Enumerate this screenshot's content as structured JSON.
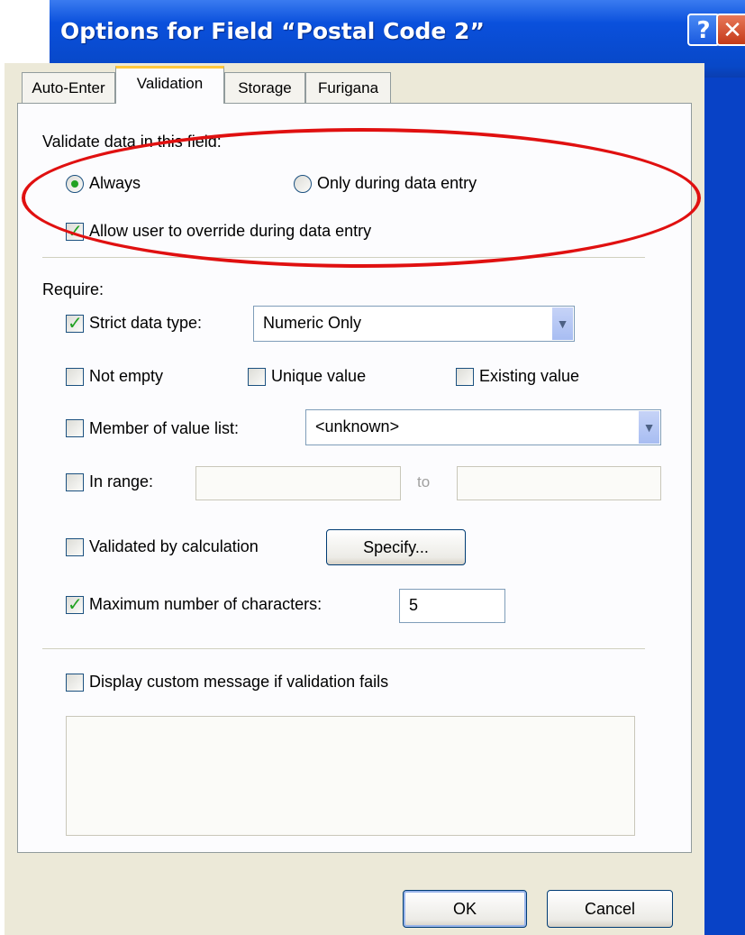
{
  "dialog": {
    "title": "Options for Field “Postal Code 2”",
    "help_icon_glyph": "?",
    "close_icon_glyph": "✕"
  },
  "tabs": [
    {
      "label": "Auto-Enter",
      "active": false
    },
    {
      "label": "Validation",
      "active": true
    },
    {
      "label": "Storage",
      "active": false
    },
    {
      "label": "Furigana",
      "active": false
    }
  ],
  "validate": {
    "heading": "Validate data in this field:",
    "always_label": "Always",
    "always_selected": true,
    "only_entry_label": "Only during data entry",
    "only_entry_selected": false,
    "override_label": "Allow user to override during data entry",
    "override_checked": true
  },
  "require": {
    "heading": "Require:",
    "strict_label": "Strict data type:",
    "strict_checked": true,
    "strict_value": "Numeric Only",
    "not_empty_label": "Not empty",
    "unique_label": "Unique value",
    "existing_label": "Existing value",
    "member_label": "Member of value list:",
    "member_value": "<unknown>",
    "range_label": "In range:",
    "range_to_label": "to",
    "calc_label": "Validated by calculation",
    "specify_label": "Specify...",
    "maxchars_label": "Maximum number of characters:",
    "maxchars_checked": true,
    "maxchars_value": "5"
  },
  "message": {
    "label": "Display custom message if validation fails",
    "checked": false,
    "text": ""
  },
  "footer": {
    "ok_label": "OK",
    "cancel_label": "Cancel"
  },
  "colors": {
    "titlebar": "#0842c6",
    "annotation": "#e01010",
    "check": "#21a121"
  }
}
